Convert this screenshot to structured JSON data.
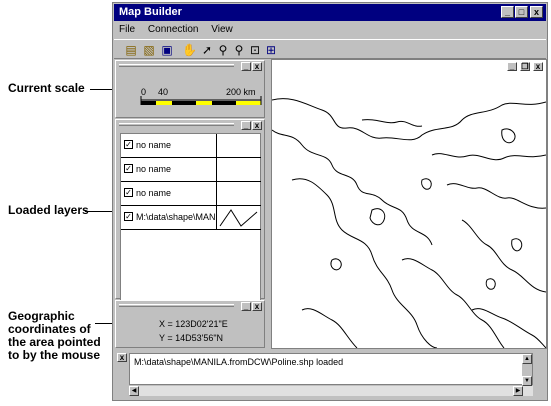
{
  "callouts": {
    "scale": "Current scale",
    "layers": "Loaded layers",
    "coords_l1": "Geographic",
    "coords_l2": "coordinates of",
    "coords_l3": "the area pointed",
    "coords_l4": "to by the mouse"
  },
  "window": {
    "title": "Map Builder",
    "minimize": "_",
    "maximize": "□",
    "close": "x"
  },
  "menu": [
    "File",
    "Connection",
    "View"
  ],
  "toolbar": {
    "icons": [
      "new-map-icon",
      "open-icon",
      "save-icon",
      "hand-pan-icon",
      "pointer-icon",
      "zoom-in-icon",
      "zoom-out-icon",
      "zoom-window-icon",
      "zoom-extents-icon"
    ]
  },
  "scale_panel": {
    "tick_0": "0",
    "tick_40": "40",
    "tick_200": "200 km"
  },
  "layers_panel": {
    "layers": [
      {
        "name": "no name",
        "checked": true
      },
      {
        "name": "no name",
        "checked": true
      },
      {
        "name": "no name",
        "checked": true
      },
      {
        "name": "M:\\data\\shape\\MANIL",
        "checked": true
      }
    ]
  },
  "coords_panel": {
    "x": "X = 123D02'21\"E",
    "y": "Y = 14D53'56\"N"
  },
  "map_window": {
    "minimize": "_",
    "restore": "❐",
    "close": "x"
  },
  "status": {
    "message": "M:\\data\\shape\\MANILA.fromDCW\\Poline.shp loaded"
  }
}
